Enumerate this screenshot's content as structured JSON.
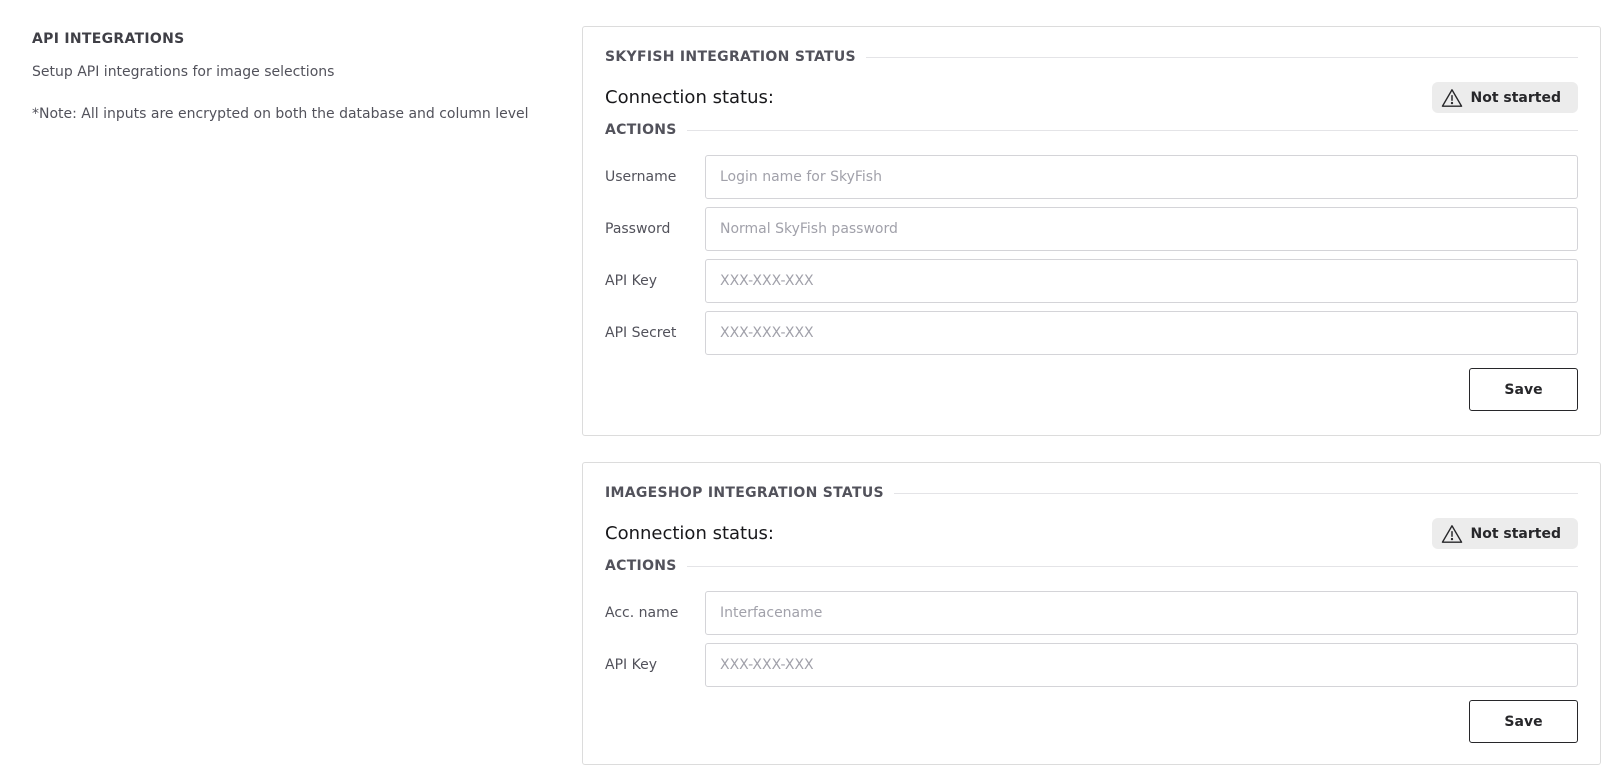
{
  "left": {
    "title": "API INTEGRATIONS",
    "description": "Setup API integrations for image selections",
    "note": "*Note: All inputs are encrypted on both the database and column level"
  },
  "skyfish": {
    "status_title": "SKYFISH INTEGRATION STATUS",
    "connection_label": "Connection status:",
    "badge_icon": "warning-triangle-icon",
    "badge_label": "Not started",
    "actions_title": "ACTIONS",
    "fields": [
      {
        "label": "Username",
        "placeholder": "Login name for SkyFish",
        "value": ""
      },
      {
        "label": "Password",
        "placeholder": "Normal SkyFish password",
        "value": ""
      },
      {
        "label": "API Key",
        "placeholder": "XXX-XXX-XXX",
        "value": ""
      },
      {
        "label": "API Secret",
        "placeholder": "XXX-XXX-XXX",
        "value": ""
      }
    ],
    "save_label": "Save"
  },
  "imageshop": {
    "status_title": "IMAGESHOP INTEGRATION STATUS",
    "connection_label": "Connection status:",
    "badge_icon": "warning-triangle-icon",
    "badge_label": "Not started",
    "actions_title": "ACTIONS",
    "fields": [
      {
        "label": "Acc. name",
        "placeholder": "Interfacename",
        "value": ""
      },
      {
        "label": "API Key",
        "placeholder": "XXX-XXX-XXX",
        "value": ""
      }
    ],
    "save_label": "Save"
  }
}
